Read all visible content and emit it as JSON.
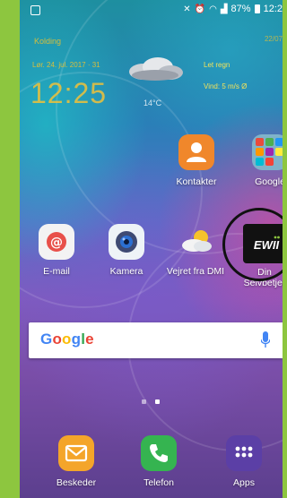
{
  "status_bar": {
    "battery": "87%",
    "time": "12:2",
    "icons": [
      "notification-icon",
      "mute-icon",
      "alarm-icon",
      "wifi-icon",
      "signal-icon",
      "battery-icon"
    ]
  },
  "clock_widget": {
    "city": "Kolding",
    "date": "Lør. 24. jul. 2017 · 31",
    "time": "12:25",
    "temperature": "14°C",
    "weather": "Let regn",
    "wind": "Vind: 5 m/s Ø",
    "updated": "22/07"
  },
  "apps": {
    "kontakter": "Kontakter",
    "google": "Google",
    "email": "E-mail",
    "kamera": "Kamera",
    "vejret": "Vejret fra DMI",
    "din": "Din",
    "din_line2": "Selvbetjer",
    "din_logo": "EWII"
  },
  "search": {
    "logo_letters": [
      "G",
      "o",
      "o",
      "g",
      "l",
      "e"
    ],
    "logo_colors": [
      "#4285f4",
      "#ea4335",
      "#fbbc05",
      "#4285f4",
      "#34a853",
      "#ea4335"
    ]
  },
  "dock": {
    "beskeder": "Beskeder",
    "telefon": "Telefon",
    "apps": "Apps"
  },
  "colors": {
    "frame_green": "#8dc63f",
    "clock_yellow": "#f0c23a",
    "contacts_orange": "#f0872b",
    "phone_green": "#35b450",
    "messages_yellow": "#f4a52a",
    "apps_purple": "#5b3fa6"
  }
}
